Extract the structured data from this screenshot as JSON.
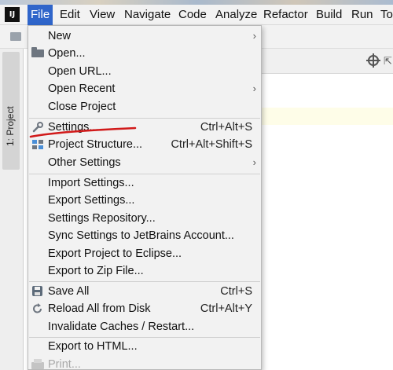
{
  "menubar": {
    "logo": "IJ",
    "items": [
      {
        "label": "File",
        "active": true
      },
      {
        "label": "Edit"
      },
      {
        "label": "View"
      },
      {
        "label": "Navigate"
      },
      {
        "label": "Code"
      },
      {
        "label": "Analyze"
      },
      {
        "label": "Refactor"
      },
      {
        "label": "Build"
      },
      {
        "label": "Run"
      },
      {
        "label": "To"
      }
    ]
  },
  "left_panel": {
    "tab_label": "1: Project",
    "icons": [
      "folder-icon"
    ]
  },
  "editor": {
    "icons": [
      "target-icon",
      "collapse-icon"
    ],
    "collapse_glyph": "⇱"
  },
  "file_menu": {
    "items": [
      {
        "label": "New",
        "submenu": true
      },
      {
        "label": "Open...",
        "icon": "folder-icon"
      },
      {
        "label": "Open URL..."
      },
      {
        "label": "Open Recent",
        "submenu": true
      },
      {
        "label": "Close Project"
      },
      {
        "label": "Settings...",
        "shortcut": "Ctrl+Alt+S",
        "icon": "wrench-icon"
      },
      {
        "label": "Project Structure...",
        "shortcut": "Ctrl+Alt+Shift+S",
        "icon": "project-structure-icon"
      },
      {
        "label": "Other Settings",
        "submenu": true
      },
      {
        "label": "Import Settings..."
      },
      {
        "label": "Export Settings..."
      },
      {
        "label": "Settings Repository..."
      },
      {
        "label": "Sync Settings to JetBrains Account..."
      },
      {
        "label": "Export Project to Eclipse..."
      },
      {
        "label": "Export to Zip File..."
      },
      {
        "label": "Save All",
        "shortcut": "Ctrl+S",
        "icon": "save-icon"
      },
      {
        "label": "Reload All from Disk",
        "shortcut": "Ctrl+Alt+Y",
        "icon": "reload-icon"
      },
      {
        "label": "Invalidate Caches / Restart..."
      },
      {
        "label": "Export to HTML..."
      },
      {
        "label": "Print...",
        "icon": "print-icon",
        "disabled": true
      }
    ],
    "submenu_arrow": "›"
  },
  "colors": {
    "menu_active": "#2f65ca",
    "annotation": "#d11a1a",
    "menu_bg": "#f2f2f2"
  }
}
